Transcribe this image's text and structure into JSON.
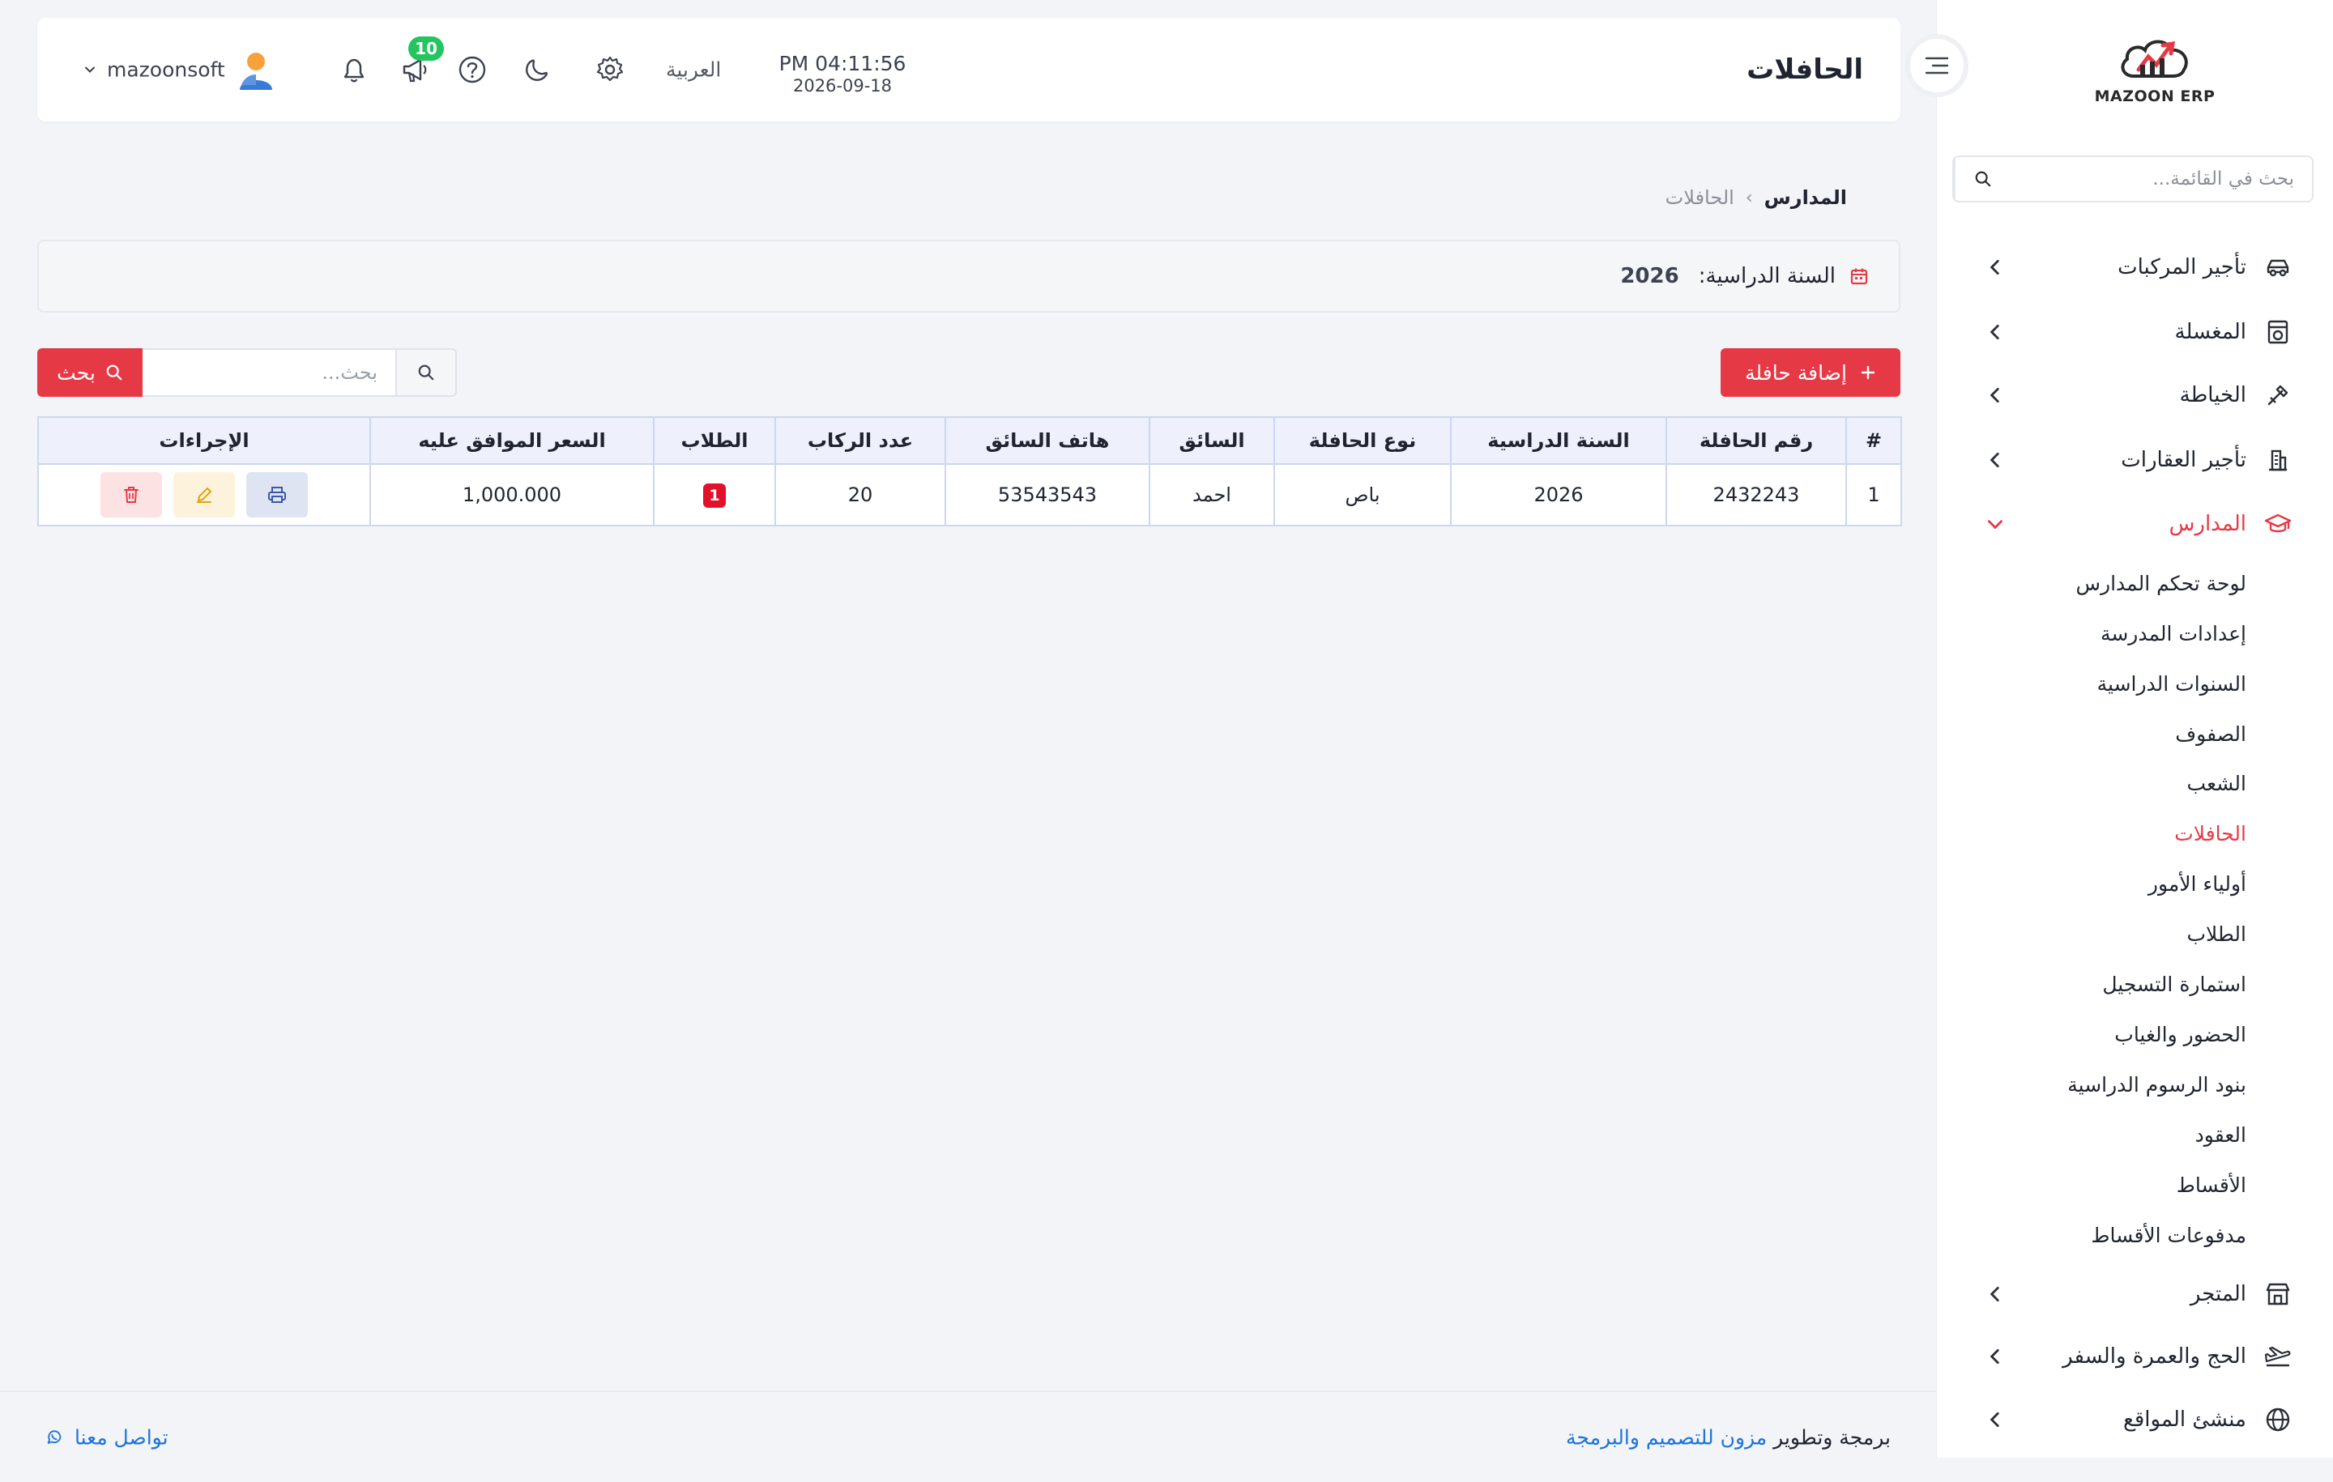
{
  "brand": {
    "name": "MAZOON ERP",
    "tagline": "ERP",
    "accent_color": "#e63946"
  },
  "topbar": {
    "title": "الحافلات",
    "time": "PM 04:11:56",
    "date": "2026-09-18",
    "language": "العربية",
    "notifications_count": "10",
    "username": "mazoonsoft"
  },
  "sidebar": {
    "search_placeholder": "بحث في القائمة...",
    "menu": [
      {
        "label": "تأجير المركبات",
        "icon": "car-icon"
      },
      {
        "label": "المغسلة",
        "icon": "laundry-icon"
      },
      {
        "label": "الخياطة",
        "icon": "sewing-icon"
      },
      {
        "label": "تأجير العقارات",
        "icon": "building-icon"
      },
      {
        "label": "المدارس",
        "icon": "graduation-cap-icon",
        "active": true
      },
      {
        "label": "المتجر",
        "icon": "store-icon"
      },
      {
        "label": "الحج والعمرة والسفر",
        "icon": "plane-icon"
      },
      {
        "label": "منشئ المواقع",
        "icon": "globe-icon"
      }
    ],
    "schools_submenu": [
      "لوحة تحكم المدارس",
      "إعدادات المدرسة",
      "السنوات الدراسية",
      "الصفوف",
      "الشعب",
      "الحافلات",
      "أولياء الأمور",
      "الطلاب",
      "استمارة التسجيل",
      "الحضور والغياب",
      "بنود الرسوم الدراسية",
      "العقود",
      "الأقساط",
      "مدفوعات الأقساط"
    ],
    "active_submenu": "الحافلات"
  },
  "breadcrumb": {
    "root": "المدارس",
    "separator": "›",
    "current": "الحافلات"
  },
  "academic_year": {
    "label": "السنة الدراسية:",
    "value": "2026"
  },
  "toolbar": {
    "add_label": "إضافة حافلة",
    "search_placeholder": "بحث...",
    "search_button": "بحث"
  },
  "table": {
    "headers": [
      "#",
      "رقم الحافلة",
      "السنة الدراسية",
      "نوع الحافلة",
      "السائق",
      "هاتف السائق",
      "عدد الركاب",
      "الطلاب",
      "السعر الموافق عليه",
      "الإجراءات"
    ],
    "rows": [
      {
        "index": "1",
        "bus_number": "2432243",
        "academic_year": "2026",
        "bus_type": "باص",
        "driver": "احمد",
        "driver_phone": "53543543",
        "passengers": "20",
        "students": "1",
        "approved_price": "1,000.000"
      }
    ]
  },
  "footer": {
    "credit_prefix": "برمجة وتطوير",
    "credit_link": "مزون للتصميم والبرمجة",
    "contact": "تواصل معنا"
  }
}
